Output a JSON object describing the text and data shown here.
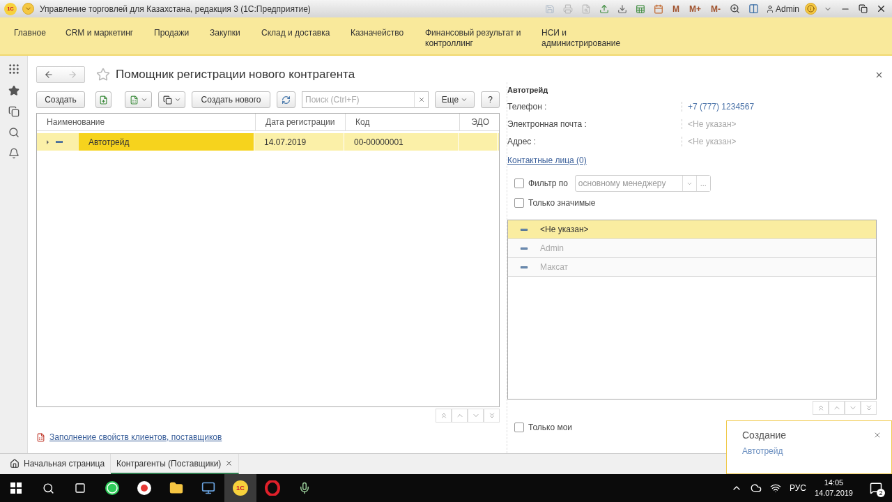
{
  "window": {
    "logo": "1С",
    "title": "Управление торговлей для Казахстана, редакция 3  (1С:Предприятие)",
    "memory_buttons": [
      "M",
      "M+",
      "M-"
    ],
    "user": "Admin"
  },
  "menu": [
    {
      "label": "Главное"
    },
    {
      "label": "CRM и маркетинг"
    },
    {
      "label": "Продажи"
    },
    {
      "label": "Закупки"
    },
    {
      "label": "Склад и доставка"
    },
    {
      "label": "Казначейство"
    },
    {
      "label": "Финансовый результат и контроллинг"
    },
    {
      "label": "НСИ и администрирование"
    }
  ],
  "form": {
    "title": "Помощник регистрации нового контрагента",
    "toolbar": {
      "create": "Создать",
      "create_new": "Создать нового",
      "search_placeholder": "Поиск (Ctrl+F)",
      "more": "Еще",
      "help": "?"
    },
    "table": {
      "columns": [
        "Наименование",
        "Дата регистрации",
        "Код",
        "ЭДО"
      ],
      "rows": [
        {
          "cells": [
            "Автотрейд",
            "14.07.2019",
            "00-00000001",
            ""
          ],
          "selected": true
        }
      ]
    },
    "report_link": "Заполнение свойств клиентов, поставщиков"
  },
  "details": {
    "name": "Автотрейд",
    "fields": [
      {
        "label": "Телефон :",
        "value": "+7 (777) 1234567",
        "kind": "link"
      },
      {
        "label": "Электронная почта :",
        "value": "<Не указан>",
        "kind": "empty"
      },
      {
        "label": "Адрес :",
        "value": "<Не указан>",
        "kind": "empty"
      }
    ],
    "contacts_link": "Контактные лица (0)",
    "filter": {
      "label": "Фильтр по",
      "checked": false,
      "value": "основному менеджеру",
      "more": "..."
    },
    "only_significant": {
      "label": "Только значимые",
      "checked": false
    },
    "managers": [
      {
        "name": "<Не указан>",
        "selected": true
      },
      {
        "name": "Admin",
        "selected": false
      },
      {
        "name": "Максат",
        "selected": false
      }
    ],
    "only_mine": {
      "label": "Только мои",
      "checked": false
    }
  },
  "tabs": [
    {
      "label": "Начальная страница",
      "selected": false
    },
    {
      "label": "Контрагенты (Поставщики)",
      "selected": true
    }
  ],
  "notification": {
    "title": "Создание",
    "link": "Автотрейд"
  },
  "taskbar": {
    "app_logo": "1С",
    "language": "РУС",
    "time": "14:05",
    "date": "14.07.2019",
    "notifications": "2"
  }
}
